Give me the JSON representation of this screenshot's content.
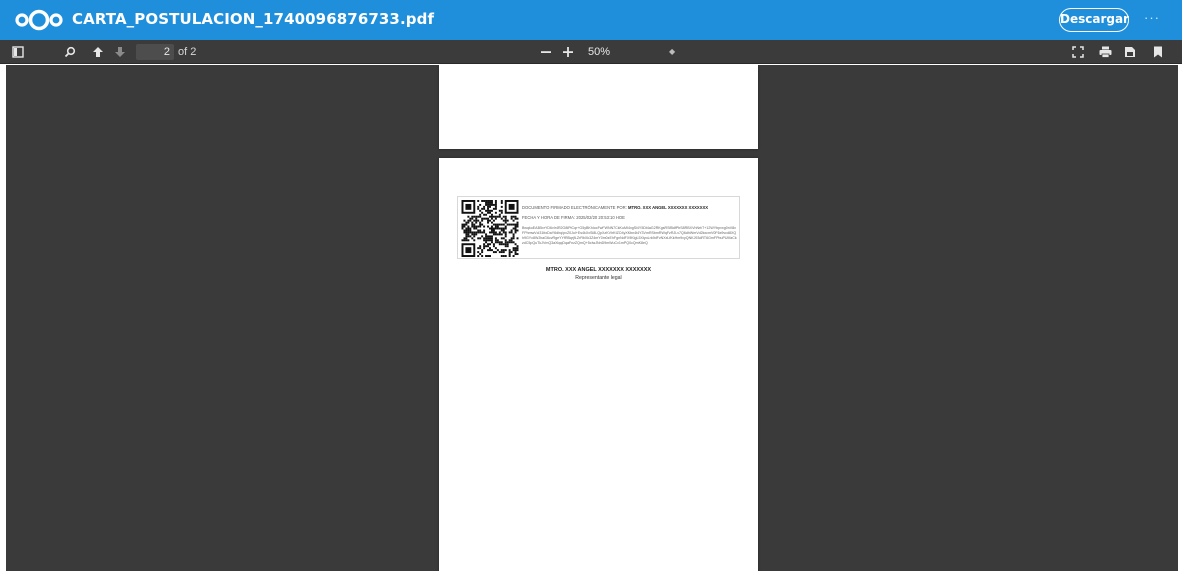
{
  "header": {
    "title": "CARTA_POSTULACION_1740096876733.pdf",
    "download_label": "Descargar",
    "more_label": "···",
    "brand_color": "#1f8fdc"
  },
  "toolbar": {
    "page_current": "2",
    "page_of": "of 2",
    "zoom_value": "50%",
    "icons": [
      "sidebar-toggle-icon",
      "search-icon",
      "page-up-icon",
      "page-down-icon",
      "zoom-out-icon",
      "zoom-in-icon",
      "presentation-mode-icon",
      "print-icon",
      "download-icon",
      "bookmark-icon"
    ]
  },
  "document": {
    "signature": {
      "line1_label": "DOCUMENTO FIRMADO ELECTRÓNICAMENTE POR:",
      "line1_name": "MTRO. XXX ANGEL XXXXXXX XXXXXXX",
      "line2": "FECHA Y HORA DE FIRMA: 2025/02/20 20:53:10 HOE",
      "hash": "BwqkuEAB5xrYD6vIr4R2O8iPtCqr+G5yBKhIocFwFWNN7CkKuMI4xgSi4Y5Dt4aG2RKgsRSfBdfPbS8RBXVhNrt/7+12WYbpvxg0nV8xFPhmwVcI31ttxDaY6dhq/pxZ0Jul+Es4kXxSi8LQpXzKVIrKtZO4yXKbn4t4Y3VmRSbmRWqFzRJLv7Q6dhWmVd2kxcmV0F6x9vcd8XQh9GYc8WJhaG6cvRgeYYfRBqrjfLZrRbXk3Z4mY0m0zEhFgnNdFX9KlgL5XtyoLrk9dFvNXxLfKkHm9vyQNKJ93dRT6GmFPbuPUMzCkzdC5pQuTkJVmQ3aXiqqDqaFnzZQmQ+5cIwJNnD9mWuCv1mPQ0cQmK8eQ"
    },
    "signer_name": "MTRO. XXX ANGEL XXXXXXX XXXXXXX",
    "signer_role": "Representante legal"
  }
}
